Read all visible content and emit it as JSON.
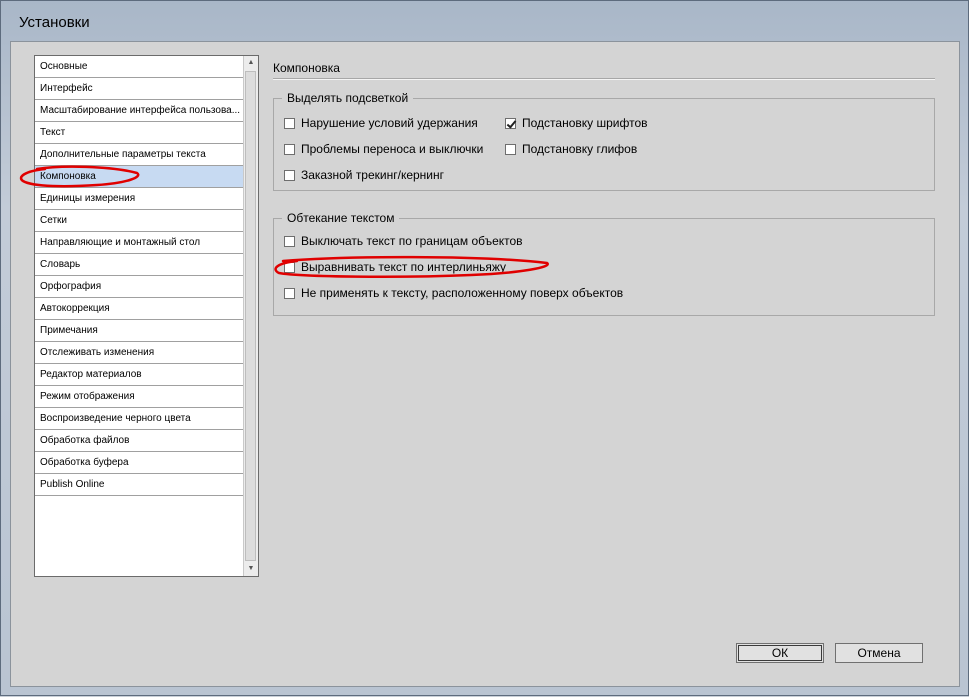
{
  "window": {
    "title": "Установки"
  },
  "categories": [
    {
      "label": "Основные"
    },
    {
      "label": "Интерфейс"
    },
    {
      "label": "Масштабирование интерфейса пользова..."
    },
    {
      "label": "Текст"
    },
    {
      "label": "Дополнительные параметры текста"
    },
    {
      "label": "Компоновка",
      "selected": true
    },
    {
      "label": "Единицы измерения"
    },
    {
      "label": "Сетки"
    },
    {
      "label": "Направляющие и монтажный стол"
    },
    {
      "label": "Словарь"
    },
    {
      "label": "Орфография"
    },
    {
      "label": "Автокоррекция"
    },
    {
      "label": "Примечания"
    },
    {
      "label": "Отслеживать изменения"
    },
    {
      "label": "Редактор материалов"
    },
    {
      "label": "Режим отображения"
    },
    {
      "label": "Воспроизведение черного цвета"
    },
    {
      "label": "Обработка файлов"
    },
    {
      "label": "Обработка буфера"
    },
    {
      "label": "Publish Online"
    }
  ],
  "panel": {
    "title": "Компоновка",
    "highlight_group": {
      "legend": "Выделять подсветкой",
      "options": [
        {
          "label": "Нарушение условий удержания",
          "checked": false
        },
        {
          "label": "Подстановку шрифтов",
          "checked": true
        },
        {
          "label": "Проблемы переноса и выключки",
          "checked": false
        },
        {
          "label": "Подстановку глифов",
          "checked": false
        },
        {
          "label": "Заказной трекинг/кернинг",
          "checked": false
        }
      ]
    },
    "wrap_group": {
      "legend": "Обтекание текстом",
      "options": [
        {
          "label": "Выключать текст по границам объектов",
          "checked": false
        },
        {
          "label": "Выравнивать текст по интерлиньяжу",
          "checked": false
        },
        {
          "label": "Не применять к тексту, расположенному поверх объектов",
          "checked": false
        }
      ]
    }
  },
  "buttons": {
    "ok": "ОК",
    "cancel": "Отмена"
  },
  "colors": {
    "selection": "#c7daf2",
    "annotation": "#e00000"
  },
  "icons": {
    "scroll_up": "scroll-up-arrow-icon",
    "scroll_down": "scroll-down-arrow-icon"
  }
}
